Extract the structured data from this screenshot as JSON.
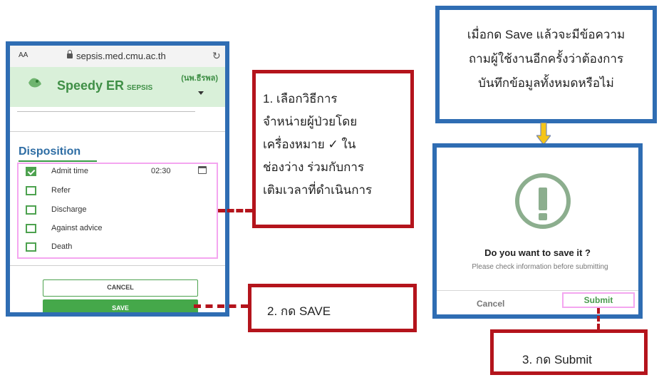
{
  "browser": {
    "aa_label": "AA",
    "url": "sepsis.med.cmu.ac.th",
    "reload_icon": "reload-icon"
  },
  "app": {
    "title": "Speedy ER",
    "subtitle": "SEPSIS",
    "user": "(นพ.ธีรพล)",
    "section_title": "Disposition",
    "options": [
      {
        "label": "Admit time",
        "checked": true,
        "time": "02:30"
      },
      {
        "label": "Refer",
        "checked": false
      },
      {
        "label": "Discharge",
        "checked": false
      },
      {
        "label": "Against advice",
        "checked": false
      },
      {
        "label": "Death",
        "checked": false
      }
    ],
    "cancel_label": "CANCEL",
    "save_label": "SAVE",
    "accent": "#45a84a"
  },
  "callouts": {
    "step1_lines": [
      "1. เลือกวิธีการ",
      "จำหน่ายผู้ป่วยโดย",
      "เครื่องหมาย ✓ ใน",
      "ช่องว่าง ร่วมกับการ",
      "เติมเวลาที่ดำเนินการ"
    ],
    "step2": "2. กด SAVE",
    "step3": "3. กด Submit",
    "note_lines": [
      "เมื่อกด Save แล้วจะมีข้อความ",
      "ถามผู้ใช้งานอีกครั้งว่าต้องการ",
      "บันทึกข้อมูลทั้งหมดหรือไม่"
    ]
  },
  "dialog": {
    "title": "Do you want to save it ?",
    "message": "Please check information before submitting",
    "cancel_label": "Cancel",
    "submit_label": "Submit",
    "icon": "warning-icon"
  },
  "colors": {
    "frame_blue": "#2f6db3",
    "callout_red": "#b4141c",
    "highlight_pink": "#f4a6f0",
    "arrow_yellow": "#f5c518"
  }
}
